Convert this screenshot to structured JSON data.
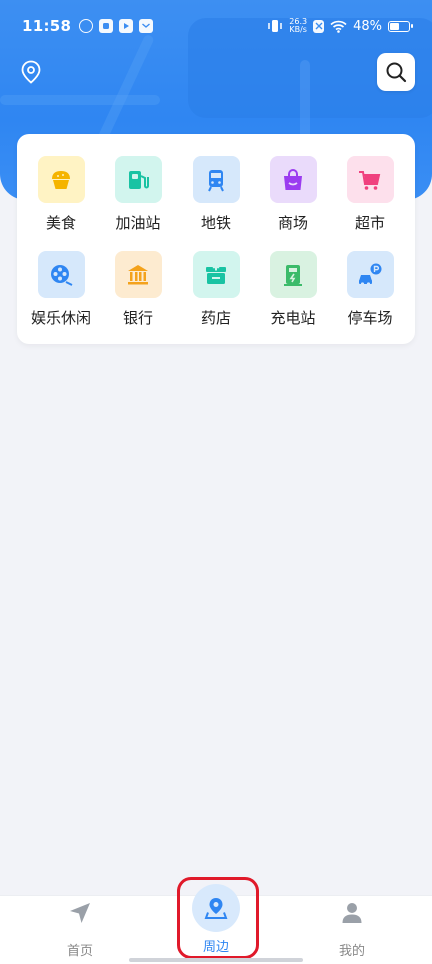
{
  "status_bar": {
    "time": "11:58",
    "net_speed_value": "26.3",
    "net_speed_unit": "KB/s",
    "battery": "48%"
  },
  "header": {
    "location_icon": "location-pin-icon",
    "search_icon": "search-icon"
  },
  "categories": [
    {
      "label": "美食",
      "icon": "food-icon",
      "bg": "#fff3c4",
      "color": "#f5b400"
    },
    {
      "label": "加油站",
      "icon": "gas-station-icon",
      "bg": "#d2f5ee",
      "color": "#19c3a3"
    },
    {
      "label": "地铁",
      "icon": "subway-icon",
      "bg": "#d6e8fb",
      "color": "#2f86f2"
    },
    {
      "label": "商场",
      "icon": "shopping-bag-icon",
      "bg": "#eadbfb",
      "color": "#9b3cf0"
    },
    {
      "label": "超市",
      "icon": "shopping-cart-icon",
      "bg": "#fde0ec",
      "color": "#f0407e"
    },
    {
      "label": "娱乐休闲",
      "icon": "film-reel-icon",
      "bg": "#d6e8fb",
      "color": "#2f86f2"
    },
    {
      "label": "银行",
      "icon": "bank-icon",
      "bg": "#fdebd0",
      "color": "#f4a21b"
    },
    {
      "label": "药店",
      "icon": "pharmacy-icon",
      "bg": "#d2f5ee",
      "color": "#19c3a3"
    },
    {
      "label": "充电站",
      "icon": "charging-station-icon",
      "bg": "#d9f2e1",
      "color": "#3cbb6a"
    },
    {
      "label": "停车场",
      "icon": "parking-icon",
      "bg": "#d6e8fb",
      "color": "#2f86f2"
    }
  ],
  "bottom_nav": {
    "items": [
      {
        "label": "首页",
        "icon": "navigation-arrow-icon"
      },
      {
        "label": "周边",
        "icon": "nearby-pin-icon",
        "active": true
      },
      {
        "label": "我的",
        "icon": "user-icon"
      }
    ]
  },
  "colors": {
    "accent": "#2f86f2",
    "highlight": "#e0192a",
    "background": "#f2f3f8"
  }
}
